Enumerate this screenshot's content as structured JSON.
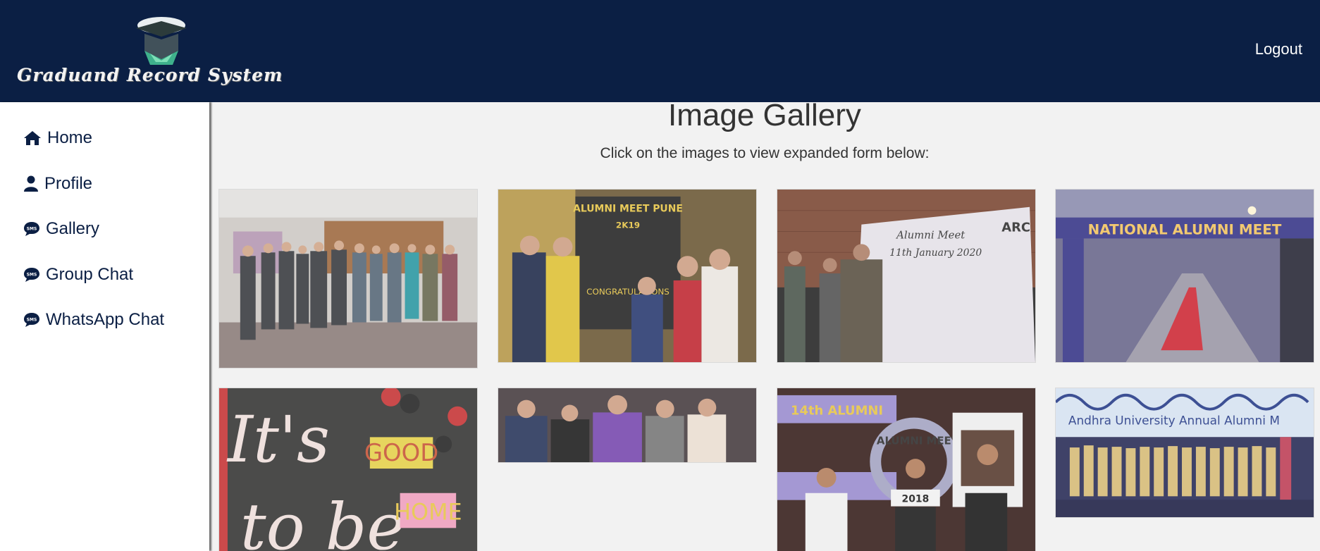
{
  "header": {
    "logo_text": "Graduand Record System",
    "logout_label": "Logout"
  },
  "sidebar": {
    "items": [
      {
        "label": "Home",
        "icon": "home-icon"
      },
      {
        "label": "Profile",
        "icon": "user-icon"
      },
      {
        "label": "Gallery",
        "icon": "sms-icon"
      },
      {
        "label": "Group Chat",
        "icon": "sms-icon"
      },
      {
        "label": "WhatsApp Chat",
        "icon": "sms-icon"
      }
    ]
  },
  "main": {
    "title": "Image Gallery",
    "subtitle": "Click on the images to view expanded form below:"
  },
  "gallery": {
    "photos": [
      {
        "caption": ""
      },
      {
        "caption": "ALUMNI MEET PUNE 2K19 CONGRATULATIONS"
      },
      {
        "caption": "Alumni Meet ARC 11th January 2020"
      },
      {
        "caption": "NATIONAL ALUMNI MEET"
      },
      {
        "caption": "It's GOOD to be HOME"
      },
      {
        "caption": ""
      },
      {
        "caption": "14th ALUMNI MEET 2018"
      },
      {
        "caption": "Andhra University Annual Alumni M"
      }
    ]
  },
  "colors": {
    "header_bg": "#0b1f44",
    "nav_text": "#0b1f44",
    "page_bg": "#f2f2f2"
  }
}
